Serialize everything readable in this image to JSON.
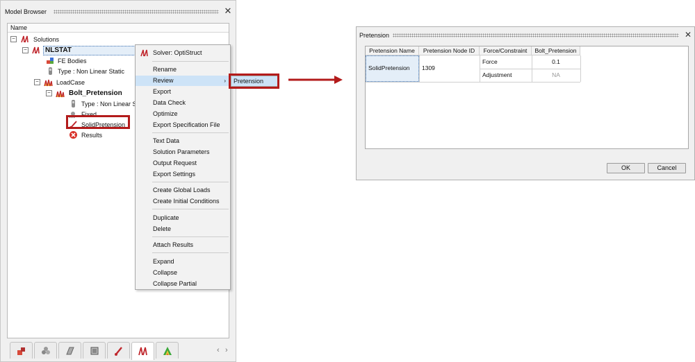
{
  "model_browser": {
    "title": "Model Browser",
    "column_header": "Name",
    "tree": {
      "solutions": "Solutions",
      "nlstat": "NLSTAT",
      "fe_bodies": "FE Bodies",
      "type_nonlinear": "Type : Non Linear Static",
      "loadcase": "LoadCase",
      "bolt_pretension": "Bolt_Pretension",
      "type_nonlinear_short": "Type : Non Linear S",
      "fixed": "Fixed",
      "solid_pretension": "SolidPretension",
      "results": "Results"
    },
    "tab_icons": [
      "part-icon",
      "assembly-icon",
      "material-icon",
      "property-icon",
      "load-icon",
      "solution-icon",
      "contour-icon"
    ]
  },
  "context_menu": {
    "header": "Solver: OptiStruct",
    "items": [
      "Rename",
      "Review",
      "Export",
      "Data Check",
      "Optimize",
      "Export Specification File",
      "Text Data",
      "Solution Parameters",
      "Output Request",
      "Export Settings",
      "Create Global Loads",
      "Create Initial Conditions",
      "Duplicate",
      "Delete",
      "Attach Results",
      "Expand",
      "Collapse",
      "Collapse Partial"
    ],
    "highlighted": "Review",
    "submenu_item": "Pretension"
  },
  "dialog": {
    "title": "Pretension",
    "columns": [
      "Pretension Name",
      "Pretension Node ID",
      "Force/Constraint",
      "Bolt_Pretension"
    ],
    "row": {
      "name": "SolidPretension",
      "node_id": "1309",
      "force_label": "Force",
      "force_value": "0.1",
      "adjustment_label": "Adjustment",
      "adjustment_value": "NA"
    },
    "ok_label": "OK",
    "cancel_label": "Cancel"
  },
  "colors": {
    "callout_red": "#b31b1b",
    "highlight": "#cde3f7"
  }
}
